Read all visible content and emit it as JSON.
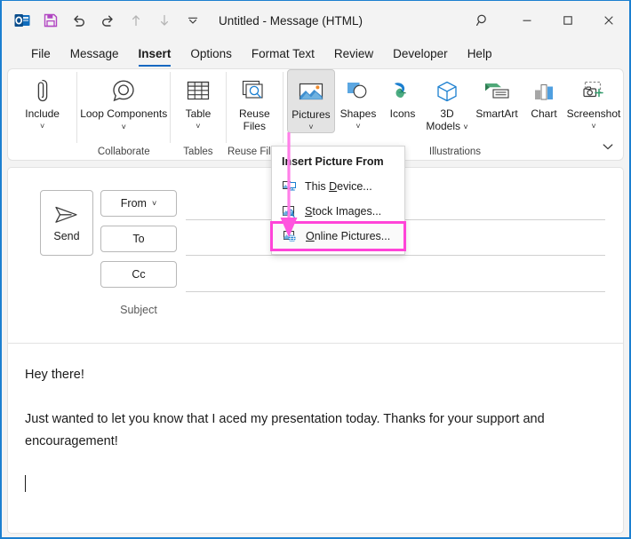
{
  "window": {
    "title": "Untitled  -  Message (HTML)",
    "accent_border": "#1b7fd0",
    "quick_access": [
      {
        "name": "outlook-logo-icon",
        "label": "Outlook"
      },
      {
        "name": "save-icon",
        "label": "Save"
      },
      {
        "name": "undo-icon",
        "label": "Undo"
      },
      {
        "name": "redo-icon",
        "label": "Redo"
      },
      {
        "name": "previous-item-icon",
        "label": "Previous Item"
      },
      {
        "name": "next-item-icon",
        "label": "Next Item"
      },
      {
        "name": "customize-quick-access-icon",
        "label": "Customize Quick Access Toolbar"
      }
    ],
    "controls": [
      {
        "name": "search-icon",
        "label": "Search"
      },
      {
        "name": "minimize-icon",
        "label": "Minimize"
      },
      {
        "name": "maximize-icon",
        "label": "Maximize"
      },
      {
        "name": "close-icon",
        "label": "Close"
      }
    ]
  },
  "tabs": [
    {
      "label": "File",
      "active": false
    },
    {
      "label": "Message",
      "active": false
    },
    {
      "label": "Insert",
      "active": true
    },
    {
      "label": "Options",
      "active": false
    },
    {
      "label": "Format Text",
      "active": false
    },
    {
      "label": "Review",
      "active": false
    },
    {
      "label": "Developer",
      "active": false
    },
    {
      "label": "Help",
      "active": false
    }
  ],
  "ribbon": {
    "active_tab": "Insert",
    "collapse_label": "Collapse the Ribbon",
    "groups": [
      {
        "label": "",
        "buttons": [
          {
            "label": "Include",
            "icon": "paperclip-icon",
            "has_chevron": true,
            "active": false
          }
        ]
      },
      {
        "label": "Collaborate",
        "buttons": [
          {
            "label": "Loop Components",
            "icon": "loop-components-icon",
            "has_chevron": true,
            "inline_chevron": true,
            "active": false
          }
        ]
      },
      {
        "label": "Tables",
        "buttons": [
          {
            "label": "Table",
            "icon": "table-icon",
            "has_chevron": true,
            "active": false
          }
        ]
      },
      {
        "label": "Reuse Files",
        "buttons": [
          {
            "label": "Reuse Files",
            "icon": "reuse-files-icon",
            "has_chevron": false,
            "active": false
          }
        ]
      },
      {
        "label": "Illustrations",
        "buttons": [
          {
            "label": "Pictures",
            "icon": "pictures-icon",
            "has_chevron": true,
            "active": true
          },
          {
            "label": "Shapes",
            "icon": "shapes-icon",
            "has_chevron": true,
            "active": false
          },
          {
            "label": "Icons",
            "icon": "icons-icon",
            "has_chevron": false,
            "active": false
          },
          {
            "label": "3D Models",
            "icon": "3d-models-icon",
            "has_chevron": true,
            "inline_chevron": true,
            "active": false
          },
          {
            "label": "SmartArt",
            "icon": "smartart-icon",
            "has_chevron": false,
            "active": false
          },
          {
            "label": "Chart",
            "icon": "chart-icon",
            "has_chevron": false,
            "active": false
          },
          {
            "label": "Screenshot",
            "icon": "screenshot-icon",
            "has_chevron": true,
            "active": false
          }
        ]
      }
    ]
  },
  "menu": {
    "header": "Insert Picture From",
    "highlight_color": "#ff44d8",
    "items": [
      {
        "label": "This Device...",
        "accel": "D",
        "icon": "picture-from-device-icon",
        "highlighted": false
      },
      {
        "label": "Stock Images...",
        "accel": "S",
        "icon": "picture-stock-images-icon",
        "highlighted": false
      },
      {
        "label": "Online Pictures...",
        "accel": "O",
        "icon": "picture-online-icon",
        "highlighted": true
      }
    ]
  },
  "compose": {
    "send_label": "Send",
    "from_label": "From",
    "to_label": "To",
    "cc_label": "Cc",
    "subject_label": "Subject",
    "from_value": "",
    "to_value": "",
    "cc_value": "",
    "subject_value": "",
    "body_paragraphs": [
      "Hey there!",
      "Just wanted to let you know that I aced my presentation today. Thanks for your support and encouragement!"
    ]
  },
  "annotation": {
    "color": "#ff7fe8",
    "description": "arrow from Pictures button to Online Pictures menu item"
  }
}
